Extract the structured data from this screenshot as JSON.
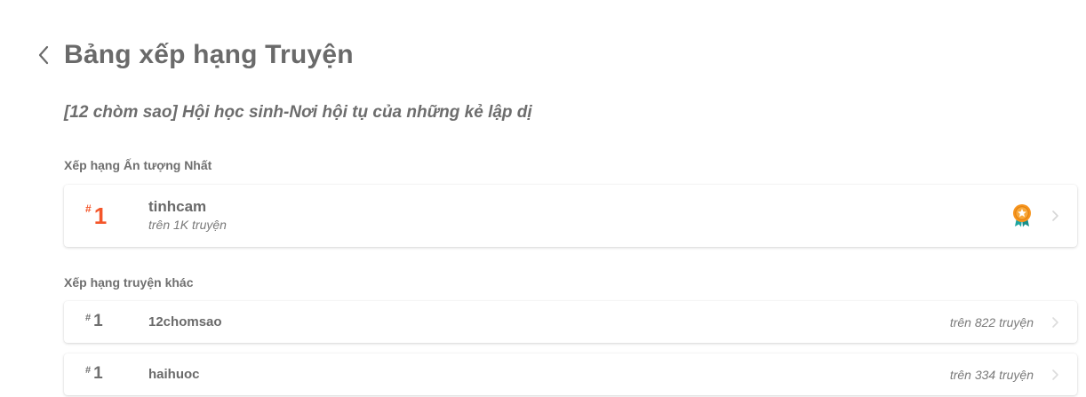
{
  "header": {
    "title": "Bảng xếp hạng Truyện",
    "back_icon": "chevron-left-icon"
  },
  "story_title": "[12 chòm sao] Hội học sinh-Nơi hội tụ của những kẻ lập dị",
  "top_section": {
    "label": "Xếp hạng Ấn tượng Nhất",
    "item": {
      "hash": "#",
      "rank": "1",
      "tag": "tinhcam",
      "subtitle": "trên 1K truyện",
      "badge_icon": "medal-icon",
      "accent_color": "#f4562a"
    }
  },
  "other_section": {
    "label": "Xếp hạng truyện khác",
    "items": [
      {
        "hash": "#",
        "rank": "1",
        "tag": "12chomsao",
        "count": "trên 822 truyện"
      },
      {
        "hash": "#",
        "rank": "1",
        "tag": "haihuoc",
        "count": "trên 334 truyện"
      }
    ]
  }
}
